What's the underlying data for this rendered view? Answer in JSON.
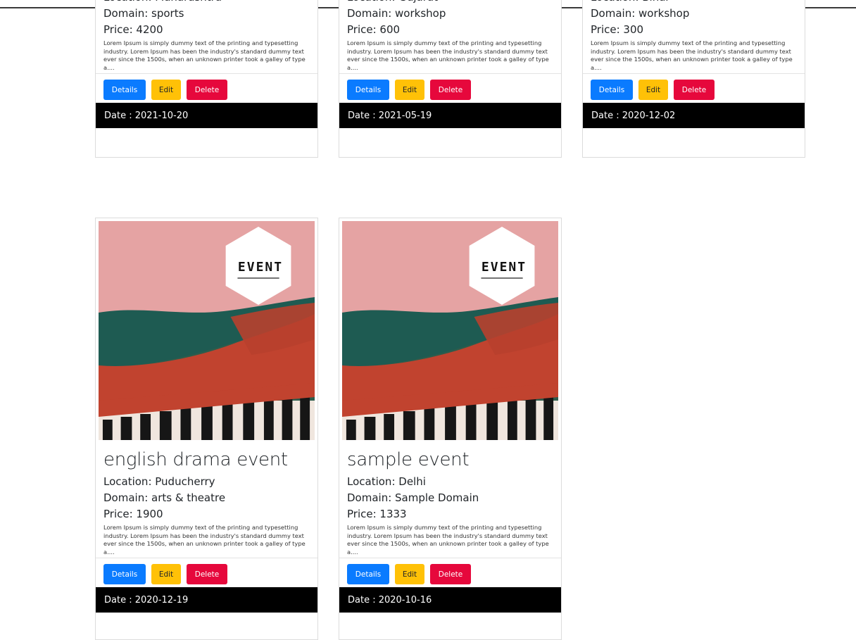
{
  "event_cards": [
    {
      "title": "",
      "location": "Location: Maharashtra",
      "domain": "Domain: sports",
      "price": "Price: 4200",
      "description": "Lorem Ipsum is simply dummy text of the printing and typesetting industry. Lorem Ipsum has been the industry's standard dummy text ever since the 1500s, when an unknown printer took a galley of type a....",
      "date": "Date : 2021-10-20"
    },
    {
      "title": "",
      "location": "Location: Gujarat",
      "domain": "Domain: workshop",
      "price": "Price: 600",
      "description": "Lorem Ipsum is simply dummy text of the printing and typesetting industry. Lorem Ipsum has been the industry's standard dummy text ever since the 1500s, when an unknown printer took a galley of type a....",
      "date": "Date : 2021-05-19"
    },
    {
      "title": "",
      "location": "Location: Bihar",
      "domain": "Domain: workshop",
      "price": "Price: 300",
      "description": "Lorem Ipsum is simply dummy text of the printing and typesetting industry. Lorem Ipsum has been the industry's standard dummy text ever since the 1500s, when an unknown printer took a galley of type a....",
      "date": "Date : 2020-12-02"
    },
    {
      "image_badge": "EVENT",
      "title": "english drama event",
      "location": "Location: Puducherry",
      "domain": "Domain: arts & theatre",
      "price": "Price: 1900",
      "description": "Lorem Ipsum is simply dummy text of the printing and typesetting industry. Lorem Ipsum has been the industry's standard dummy text ever since the 1500s, when an unknown printer took a galley of type a....",
      "date": "Date : 2020-12-19"
    },
    {
      "image_badge": "EVENT",
      "title": "sample event",
      "location": "Location: Delhi",
      "domain": "Domain: Sample Domain",
      "price": "Price: 1333",
      "description": "Lorem Ipsum is simply dummy text of the printing and typesetting industry. Lorem Ipsum has been the industry's standard dummy text ever since the 1500s, when an unknown printer took a galley of type a....",
      "date": "Date : 2020-10-16"
    }
  ],
  "buttons": {
    "details": "Details",
    "edit": "Edit",
    "delete": "Delete"
  },
  "colors": {
    "details": "#0a7bff",
    "edit": "#ffc107",
    "delete": "#e6083c",
    "date_bar": "#000000"
  },
  "icons": {
    "event_image": "event-poster-image"
  }
}
